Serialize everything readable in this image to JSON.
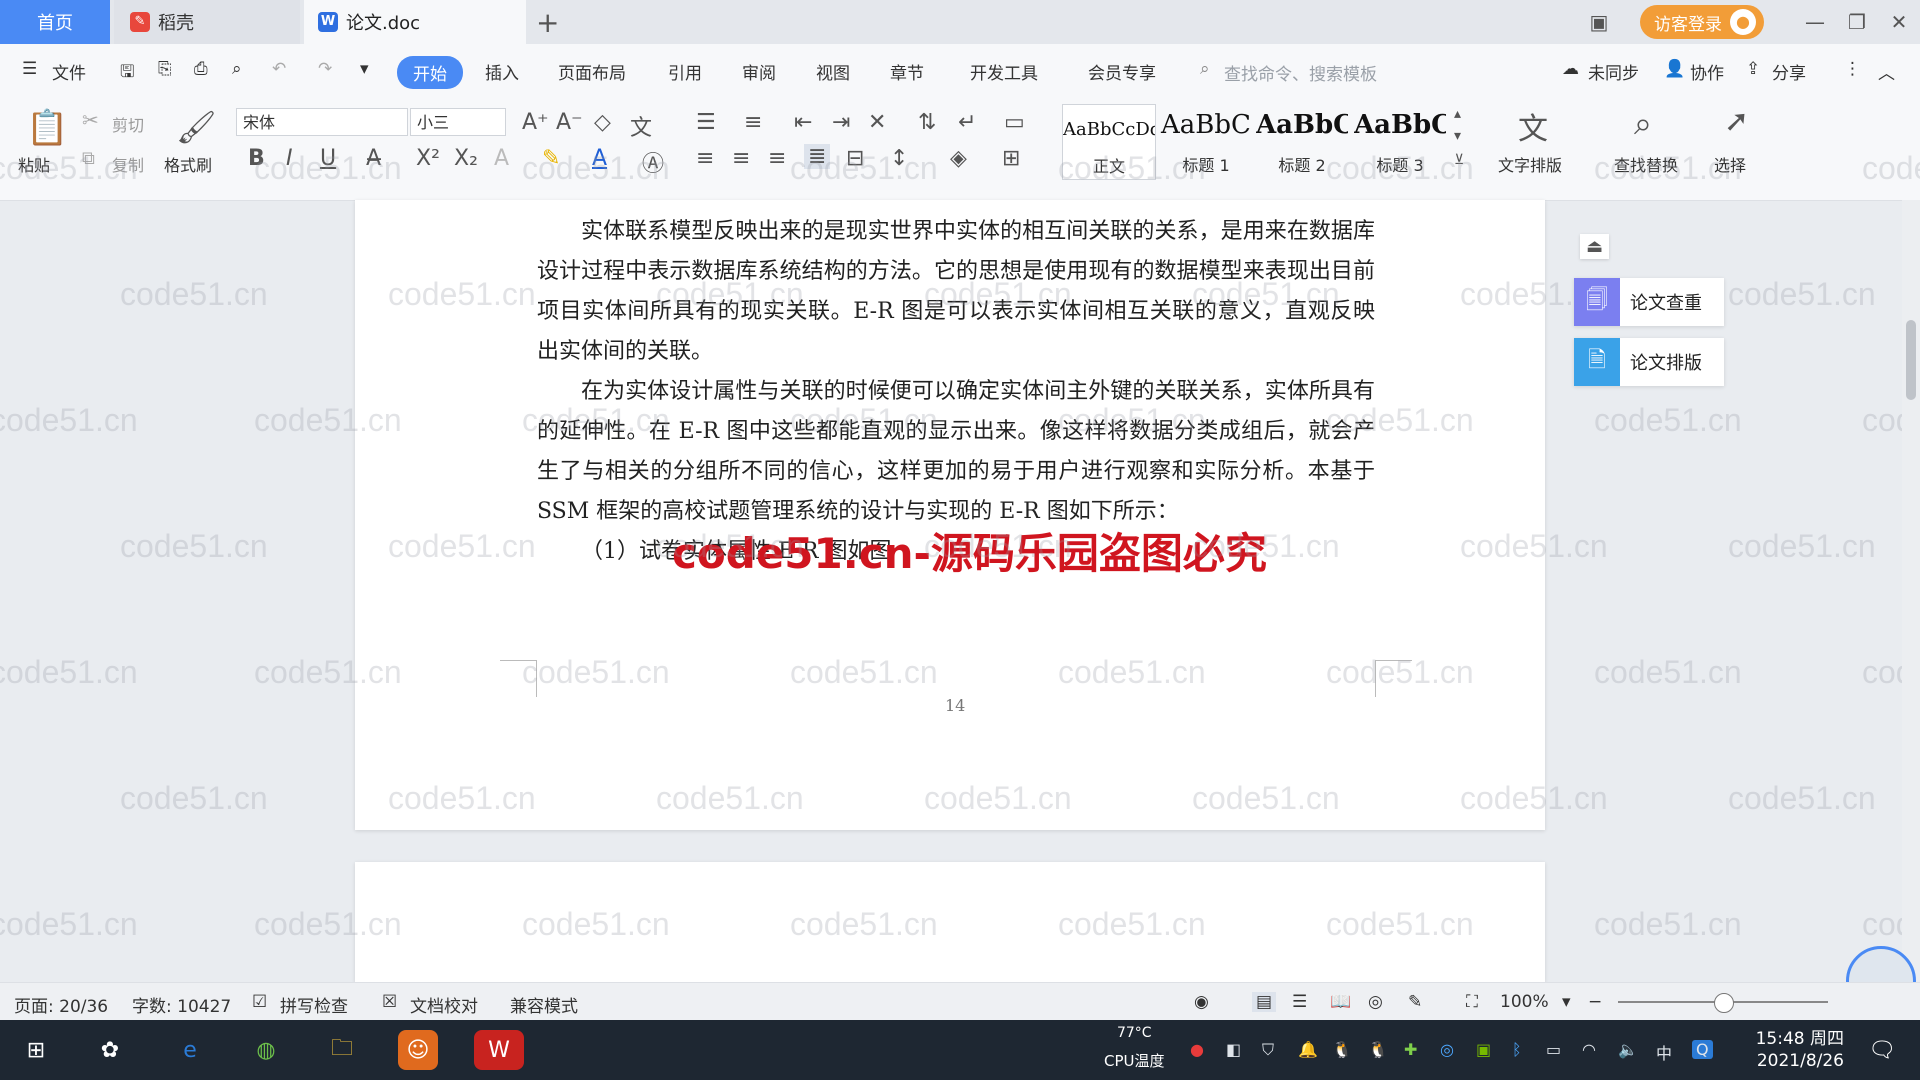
{
  "tabs": {
    "home": "首页",
    "daoke": "稻壳",
    "doc": "论文.doc",
    "add": "+"
  },
  "header": {
    "visitor_login": "访客登录"
  },
  "menu": {
    "file": "文件",
    "items": [
      "开始",
      "插入",
      "页面布局",
      "引用",
      "审阅",
      "视图",
      "章节",
      "开发工具",
      "会员专享"
    ],
    "search_placeholder": "查找命令、搜索模板",
    "sync": "未同步",
    "collab": "协作",
    "share": "分享"
  },
  "toolbar": {
    "paste": "粘贴",
    "cut": "剪切",
    "copy": "复制",
    "format_painter": "格式刷",
    "font": "宋体",
    "font_size": "小三",
    "styles": [
      {
        "sample": "AaBbCcDd",
        "label": "正文"
      },
      {
        "sample": "AaBbC",
        "label": "标题 1"
      },
      {
        "sample": "AaBbC",
        "label": "标题 2"
      },
      {
        "sample": "AaBbC",
        "label": "标题 3"
      }
    ],
    "text_layout": "文字排版",
    "find_replace": "查找替换",
    "select": "选择"
  },
  "document": {
    "paragraphs": [
      "实体联系模型反映出来的是现实世界中实体的相互间关联的关系，是用来在数据库设计过程中表示数据库系统结构的方法。它的思想是使用现有的数据模型来表现出目前项目实体间所具有的现实关联。E-R 图是可以表示实体间相互关联的意义，直观反映出实体间的关联。",
      "在为实体设计属性与关联的时候便可以确定实体间主外键的关联关系，实体所具有的延伸性。在 E-R 图中这些都能直观的显示出来。像这样将数据分类成组后，就会产生了与相关的分组所不同的信心，这样更加的易于用户进行观察和实际分析。本基于 SSM 框架的高校试题管理系统的设计与实现的 E-R 图如下所示：",
      "（1）试卷实体属性 E-R 图如图"
    ],
    "red_watermark": "code51.cn-源码乐园盗图必究",
    "page_number": "14",
    "watermark_text": "code51.cn"
  },
  "side_panel": {
    "check": "论文查重",
    "layout": "论文排版"
  },
  "status": {
    "page": "页面: 20/36",
    "words": "字数: 10427",
    "spell": "拼写检查",
    "proof": "文档校对",
    "compat": "兼容模式",
    "zoom": "100%",
    "zoom_level": 1.0
  },
  "taskbar": {
    "cpu_temp": "77°C",
    "cpu_label": "CPU温度",
    "ime": "中",
    "time": "15:48 周四",
    "date": "2021/8/26"
  },
  "colors": {
    "accent": "#4a8af4",
    "login": "#f29d38",
    "red_mark": "#d0151f"
  }
}
